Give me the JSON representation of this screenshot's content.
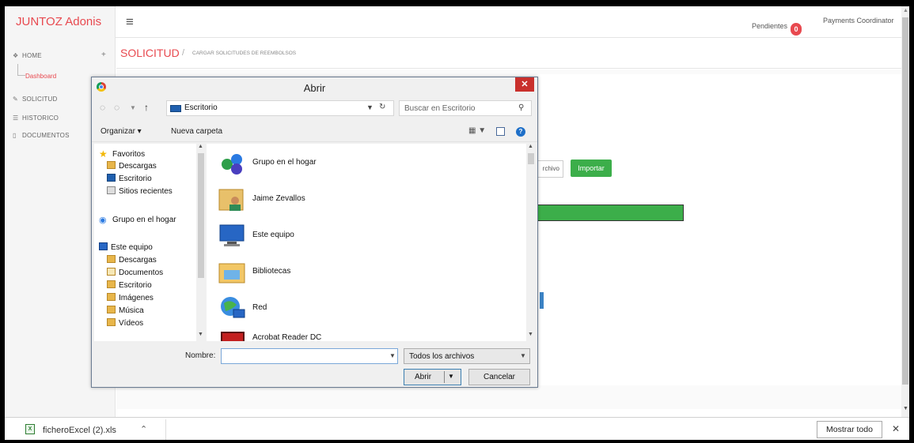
{
  "app": {
    "brand": "JUNTOZ Adonis",
    "pending_label": "Pendientes",
    "pending_count": "0",
    "user_role": "Payments Coordinator"
  },
  "sidebar": {
    "items": [
      {
        "label": "HOME",
        "icon": "home-icon"
      },
      {
        "label": "Dashboard",
        "icon": "tree-branch"
      },
      {
        "label": "SOLICITUD",
        "icon": "edit-icon"
      },
      {
        "label": "HISTORICO",
        "icon": "list-icon"
      },
      {
        "label": "DOCUMENTOS",
        "icon": "folder-icon"
      }
    ]
  },
  "breadcrumb": {
    "title": "SOLICITUD",
    "separator": "/",
    "subtitle": "CARGAR SOLICITUDES DE REEMBOLSOS"
  },
  "page": {
    "file_button_label": "rchivo",
    "import_button_label": "Importar"
  },
  "download_bar": {
    "file_name": "ficheroExcel (2).xls",
    "show_all_label": "Mostrar todo"
  },
  "dialog": {
    "title": "Abrir",
    "address": "Escritorio",
    "search_placeholder": "Buscar en Escritorio",
    "organize_label": "Organizar ▾",
    "new_folder_label": "Nueva carpeta",
    "nav_pane": [
      {
        "label": "Favoritos",
        "icon": "star-icon"
      },
      {
        "label": "Descargas",
        "icon": "downloads-folder-icon"
      },
      {
        "label": "Escritorio",
        "icon": "desktop-icon"
      },
      {
        "label": "Sitios recientes",
        "icon": "recent-places-icon"
      },
      {
        "label": "Grupo en el hogar",
        "icon": "homegroup-icon"
      },
      {
        "label": "Este equipo",
        "icon": "computer-icon"
      },
      {
        "label": "Descargas",
        "icon": "downloads-folder-icon"
      },
      {
        "label": "Documentos",
        "icon": "documents-folder-icon"
      },
      {
        "label": "Escritorio",
        "icon": "desktop-folder-icon"
      },
      {
        "label": "Imágenes",
        "icon": "pictures-folder-icon"
      },
      {
        "label": "Música",
        "icon": "music-folder-icon"
      },
      {
        "label": "Vídeos",
        "icon": "videos-folder-icon"
      }
    ],
    "files": [
      {
        "label": "Grupo en el hogar",
        "icon": "homegroup-icon"
      },
      {
        "label": "Jaime Zevallos",
        "icon": "user-folder-icon"
      },
      {
        "label": "Este equipo",
        "icon": "computer-icon"
      },
      {
        "label": "Bibliotecas",
        "icon": "libraries-icon"
      },
      {
        "label": "Red",
        "icon": "network-icon"
      },
      {
        "label": "Acrobat Reader DC",
        "icon": "acrobat-icon"
      }
    ],
    "name_label": "Nombre:",
    "name_value": "",
    "file_type": "Todos los archivos",
    "open_label": "Abrir",
    "cancel_label": "Cancelar"
  },
  "colors": {
    "brand_red": "#e8494f",
    "import_green": "#3cae4a",
    "dialog_close_red": "#c9302c",
    "link_blue": "#1e6fc8"
  }
}
